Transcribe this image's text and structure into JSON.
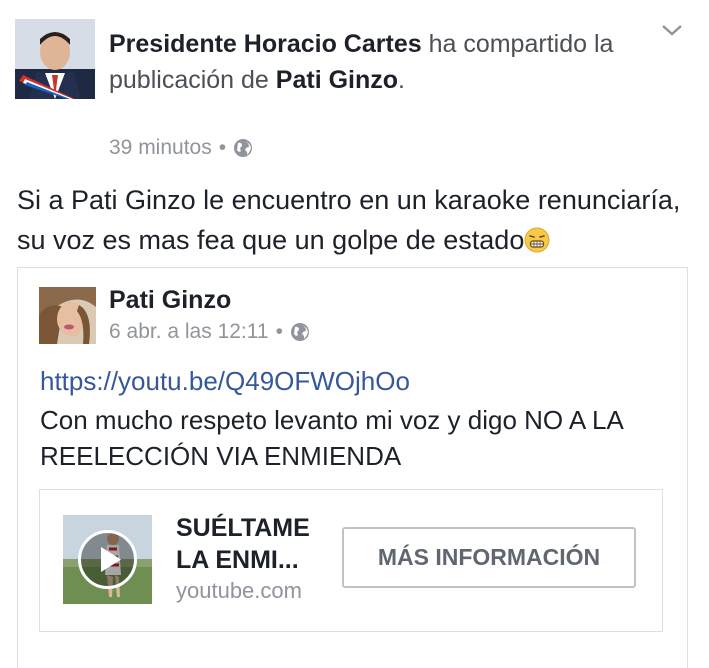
{
  "post": {
    "author": "Presidente Horacio Cartes",
    "action_text": "ha compartido la publicación de",
    "shared_from": "Pati Ginzo",
    "punct": ".",
    "time": "39 minutos",
    "separator": "•",
    "privacy_icon": "globe-icon",
    "text_line1": "Si a Pati Ginzo le encuentro en un karaoke renunciaría,",
    "text_line2": "su voz es mas fea que un golpe de estado",
    "emoji": "grimacing-face-emoji"
  },
  "shared": {
    "author": "Pati Ginzo",
    "time": "6 abr. a las 12:11",
    "separator": "•",
    "privacy_icon": "globe-icon",
    "link": "https://youtu.be/Q49OFWOjhOo",
    "text_line1": "Con mucho respeto levanto mi voz y digo NO A LA",
    "text_line2": "REELECCIÓN VIA ENMIENDA"
  },
  "link_preview": {
    "title_line1": "SUÉLTAME",
    "title_line2": "LA ENMI...",
    "domain": "youtube.com",
    "button_label": "MÁS INFORMACIÓN"
  },
  "colors": {
    "link": "#365899",
    "meta": "#90949c",
    "text": "#1d2129"
  }
}
